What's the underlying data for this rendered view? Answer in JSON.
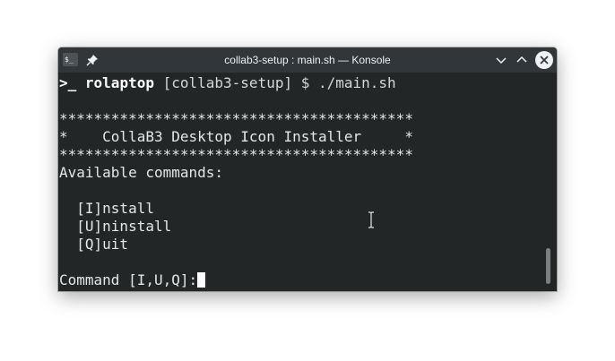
{
  "window": {
    "title": "collab3-setup : main.sh — Konsole",
    "app_icon_text": "$_",
    "icons": {
      "app": "terminal-icon",
      "pin": "pin-icon",
      "minimize": "chevron-down-icon",
      "maximize": "chevron-up-icon",
      "close": "close-icon"
    }
  },
  "terminal": {
    "prompt_symbol": ">_",
    "host": "rolaptop",
    "command_rest": " [collab3-setup] $ ./main.sh",
    "banner_border": "*****************************************",
    "banner_title": "*    CollaB3 Desktop Icon Installer     *",
    "available_label": "Available commands:",
    "options": [
      "  [I]nstall",
      "  [U]ninstall",
      "  [Q]uit"
    ],
    "command_prompt": "Command [I,U,Q]:"
  },
  "colors": {
    "terminal_bg": "#232627",
    "titlebar_bg": "#31363b",
    "text": "#e6e6e6"
  }
}
